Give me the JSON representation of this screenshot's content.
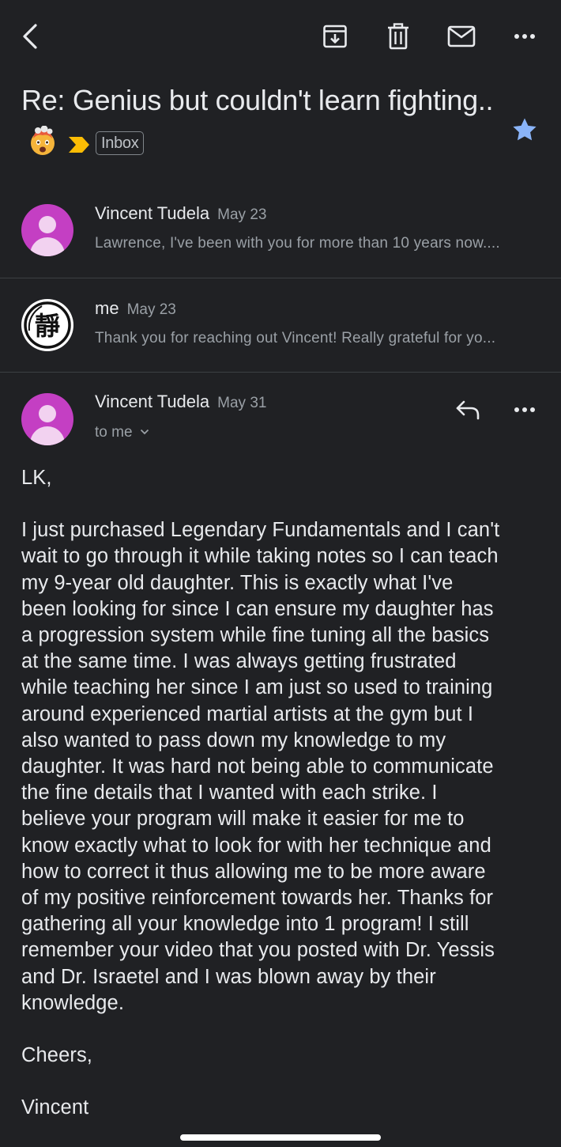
{
  "toolbar": {
    "back": "chevron-left-icon",
    "archive": "archive-icon",
    "delete": "trash-icon",
    "mark_unread": "mail-icon",
    "more": "more-horizontal-icon"
  },
  "thread": {
    "subject": "Re: Genius but couldn't learn fighting..",
    "emoji": "exploding-head-emoji",
    "label": "Inbox",
    "starred": true,
    "star_color": "#8ab4f8",
    "importance_color": "#fbbc04"
  },
  "messages": [
    {
      "sender": "Vincent Tudela",
      "date": "May 23",
      "snippet": "Lawrence, I've been with you for more than 10 years now...."
    },
    {
      "sender": "me",
      "date": "May 23",
      "snippet": "Thank you for reaching out Vincent! Really grateful for yo..."
    }
  ],
  "open_message": {
    "sender": "Vincent Tudela",
    "date": "May 31",
    "recipient": "to me",
    "avatar_color": "#c43fc3",
    "greeting": "LK,",
    "body": "I just purchased Legendary Fundamentals and I can't\nwait to go through it while taking notes so I can teach\nmy 9-year old daughter. This is exactly what I've\nbeen looking for since I can ensure my daughter has\na progression system while fine tuning all the basics\nat the same time. I was always getting frustrated\nwhile teaching her since I am just so used to training\naround experienced martial artists at the gym but I\nalso wanted to pass down my knowledge to my\ndaughter. It was hard not being able to communicate\nthe fine details that I wanted with each strike. I\nbelieve your program will make it easier for me to\nknow exactly what to look for with her technique and\nhow to correct it thus allowing me to be more aware\nof my positive reinforcement towards her. Thanks for\ngathering all your knowledge into 1 program! I still\nremember your video that you posted with Dr. Yessis\nand Dr. Israetel and I was blown away by their\nknowledge.",
    "signoff": "Cheers,",
    "signature": "Vincent"
  }
}
